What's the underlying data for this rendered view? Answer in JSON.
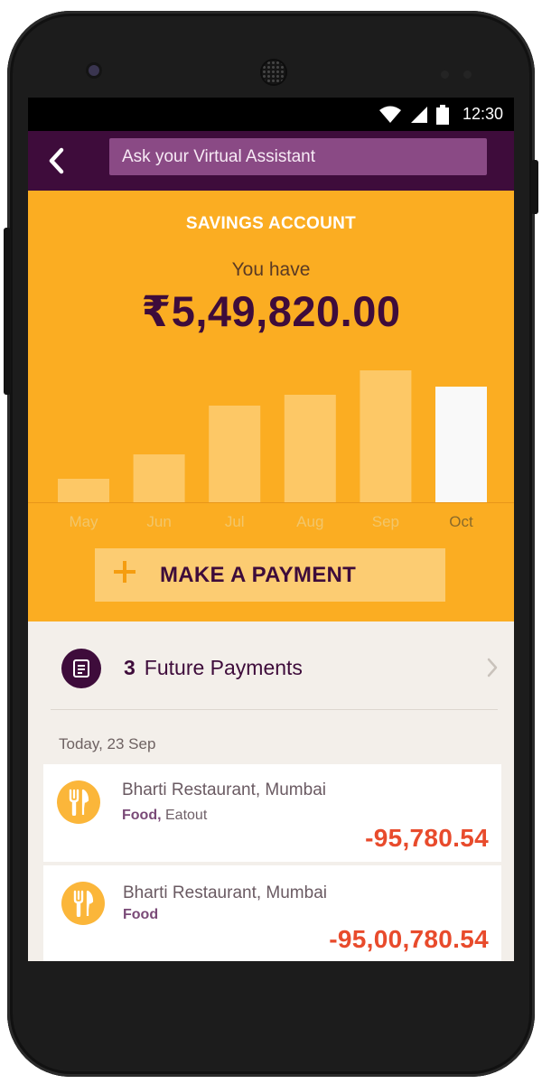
{
  "status_bar": {
    "time": "12:30"
  },
  "app_bar": {
    "search_placeholder": "Ask your Virtual Assistant"
  },
  "account": {
    "title": "SAVINGS ACCOUNT",
    "subtitle": "You have",
    "balance": "₹5,49,820.00"
  },
  "chart_data": {
    "type": "bar",
    "categories": [
      "May",
      "Jun",
      "Jul",
      "Aug",
      "Sep",
      "Oct"
    ],
    "values": [
      26,
      53,
      107,
      119,
      146,
      128
    ],
    "highlighted": "Oct",
    "colors": {
      "bar": "#fdc866",
      "highlight": "#f9f9f9",
      "label": "#f2c66a",
      "highlight_label": "#8a6a2a"
    }
  },
  "actions": {
    "make_payment_label": "MAKE A PAYMENT"
  },
  "future_payments": {
    "count": "3",
    "label": "Future Payments"
  },
  "transactions_date": "Today, 23 Sep",
  "transactions": [
    {
      "merchant": "Bharti Restaurant, Mumbai",
      "category": "Food,",
      "subcategory": "Eatout",
      "amount": "-95,780.54"
    },
    {
      "merchant": "Bharti Restaurant, Mumbai",
      "category": "Food",
      "subcategory": "",
      "amount": "-95,00,780.54"
    }
  ],
  "theme": {
    "primary": "#3e0c3b",
    "accent": "#fbad22",
    "negative": "#e84b2c"
  }
}
